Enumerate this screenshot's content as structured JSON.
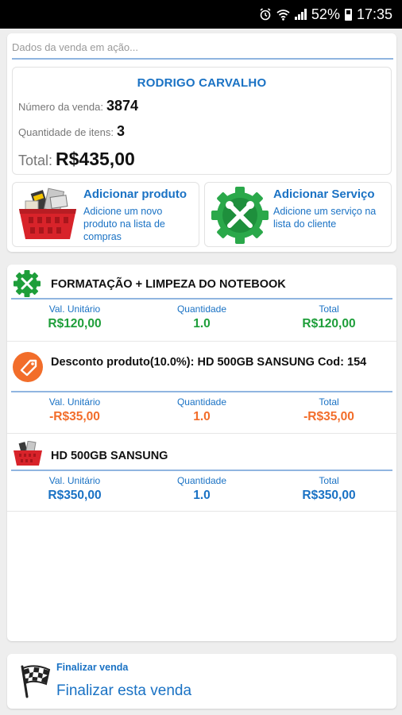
{
  "status_bar": {
    "icons": [
      "alarm-icon",
      "wifi-icon",
      "signal-icon",
      "battery-icon"
    ],
    "battery": "52%",
    "time": "17:35"
  },
  "sale": {
    "section_hint": "Dados da venda em ação...",
    "client_name": "RODRIGO CARVALHO",
    "number_label": "Número da venda:",
    "number": "3874",
    "items_label": "Quantidade de itens:",
    "items": "3",
    "total_label": "Total:",
    "total": "R$435,00"
  },
  "actions": {
    "add_product": {
      "title": "Adicionar produto",
      "desc": "Adicione um novo produto na lista de compras",
      "icon": "shopping-basket-icon"
    },
    "add_service": {
      "title": "Adicionar Serviço",
      "desc": "Adicione um serviço na lista do cliente",
      "icon": "service-gear-tools-icon"
    }
  },
  "column_headers": {
    "unit": "Val. Unitário",
    "qty": "Quantidade",
    "total": "Total"
  },
  "items": [
    {
      "title": "FORMATAÇÃO + LIMPEZA DO NOTEBOOK",
      "unit": "R$120,00",
      "qty": "1.0",
      "total": "R$120,00",
      "icon": "service-gear-icon",
      "color": "#1e9e3a"
    },
    {
      "title": "Desconto produto(10.0%): HD 500GB SANSUNG Cod: 154",
      "unit": "-R$35,00",
      "qty": "1.0",
      "total": "-R$35,00",
      "icon": "discount-tag-icon",
      "color": "#f26d2a"
    },
    {
      "title": "HD 500GB SANSUNG",
      "unit": "R$350,00",
      "qty": "1.0",
      "total": "R$350,00",
      "icon": "product-basket-icon",
      "color": "#1a72c4"
    }
  ],
  "finish": {
    "label": "Finalizar venda",
    "action": "Finalizar esta venda",
    "icon": "checkered-flag-icon"
  },
  "colors": {
    "accent": "#1a72c4",
    "service_green": "#1e9e3a",
    "discount_orange": "#f26d2a",
    "divider_blue": "#90b5e0"
  }
}
